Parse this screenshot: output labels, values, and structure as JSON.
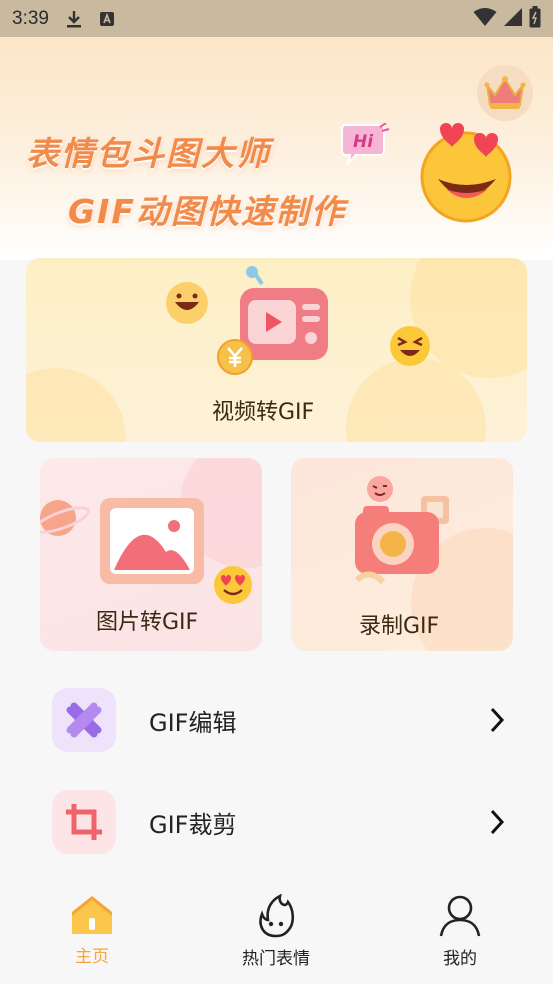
{
  "status_bar": {
    "time": "3:39"
  },
  "hero": {
    "title_line1": "表情包斗图大师",
    "title_line2": "GIF动图快速制作",
    "badge_text": "Hi"
  },
  "cards": {
    "video_to_gif": "视频转GIF",
    "image_to_gif": "图片转GIF",
    "record_gif": "录制GIF"
  },
  "list": [
    {
      "label": "GIF编辑",
      "icon": "scissors-icon"
    },
    {
      "label": "GIF裁剪",
      "icon": "crop-icon"
    }
  ],
  "nav": {
    "items": [
      {
        "label": "主页",
        "icon": "home-icon",
        "active": true
      },
      {
        "label": "热门表情",
        "icon": "fire-face-icon",
        "active": false
      },
      {
        "label": "我的",
        "icon": "person-icon",
        "active": false
      }
    ]
  },
  "colors": {
    "accent": "#f7a53b",
    "hero_text": "#f28a49",
    "status_bar": "#c9b99f"
  }
}
